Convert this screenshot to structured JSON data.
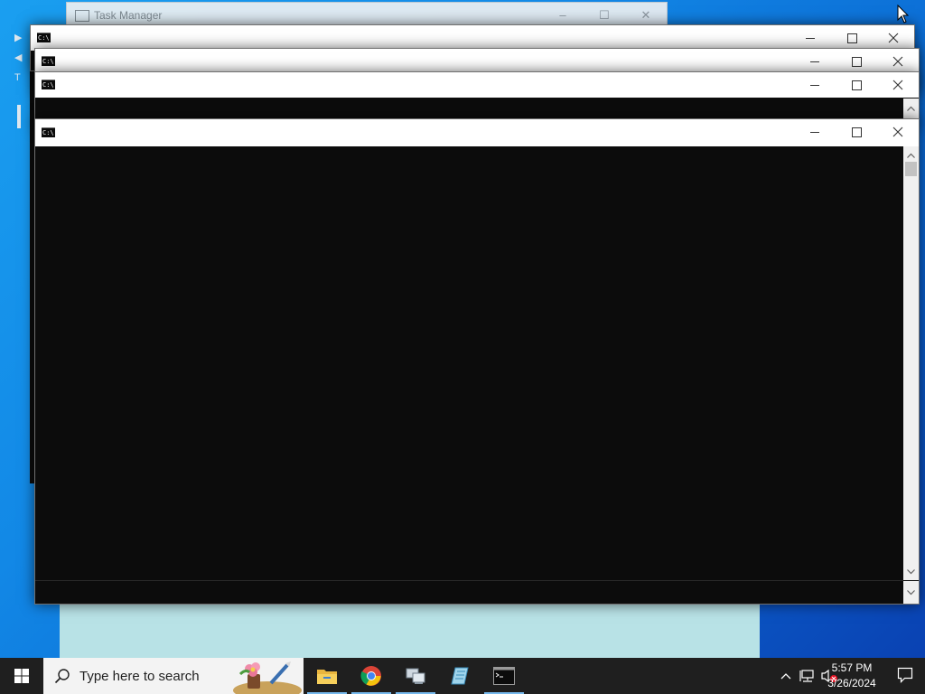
{
  "desktop": {
    "background_color": "#1288e6"
  },
  "task_manager": {
    "title": "Task Manager",
    "controls": [
      "–",
      "☐",
      "✕"
    ]
  },
  "consoles": [
    {
      "id": "console-1",
      "icon": "C:\\",
      "title": ""
    },
    {
      "id": "console-2",
      "icon": "C:\\",
      "title": ""
    },
    {
      "id": "console-3",
      "icon": "C:\\",
      "title": ""
    },
    {
      "id": "console-4",
      "icon": "C:\\",
      "title": ""
    }
  ],
  "taskbar": {
    "search_placeholder": "Type here to search",
    "apps": [
      {
        "name": "file-explorer",
        "active": true
      },
      {
        "name": "chrome",
        "active": true
      },
      {
        "name": "network-app",
        "active": true
      },
      {
        "name": "notepad-app",
        "active": false
      },
      {
        "name": "command-prompt",
        "active": true
      }
    ],
    "clock_time": "5:57 PM",
    "clock_date": "3/26/2024",
    "accent_color": "#76b9ed"
  }
}
